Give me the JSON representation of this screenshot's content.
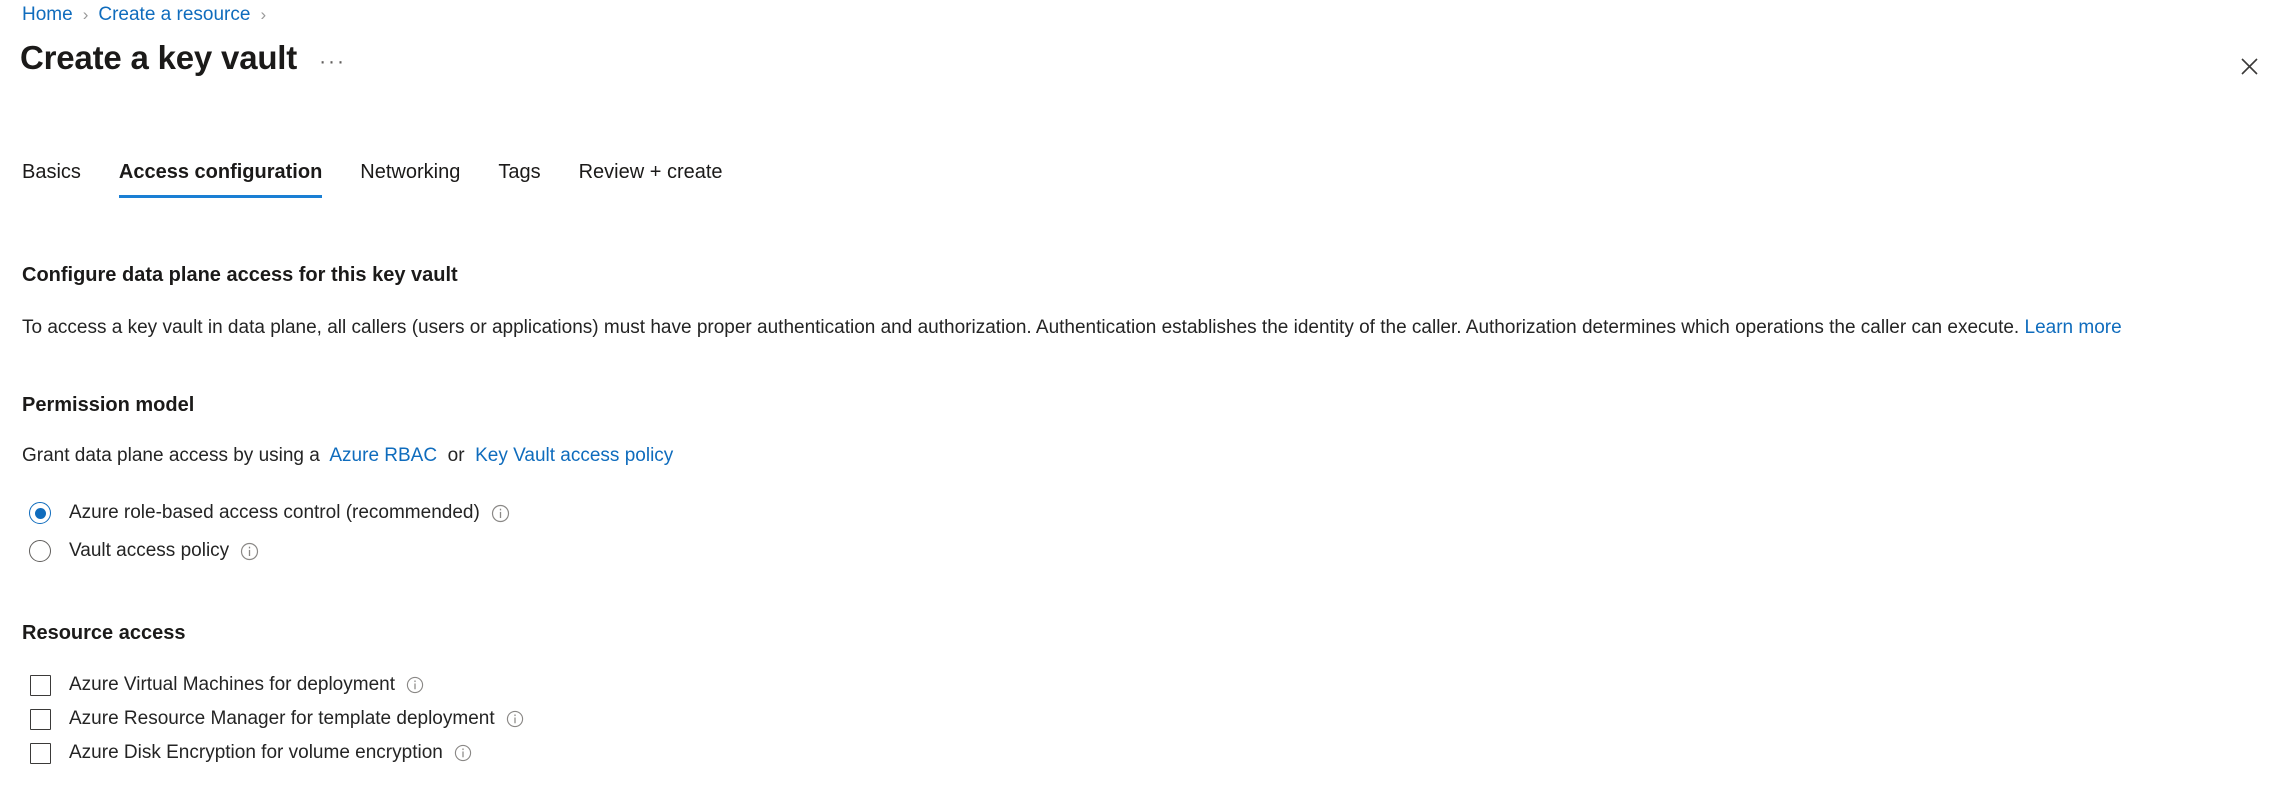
{
  "breadcrumb": {
    "items": [
      {
        "label": "Home"
      },
      {
        "label": "Create a resource"
      }
    ],
    "separator": "›"
  },
  "header": {
    "title": "Create a key vault",
    "more_label": "···",
    "close_label": "Close"
  },
  "tabs": [
    {
      "label": "Basics",
      "active": false
    },
    {
      "label": "Access configuration",
      "active": true
    },
    {
      "label": "Networking",
      "active": false
    },
    {
      "label": "Tags",
      "active": false
    },
    {
      "label": "Review + create",
      "active": false
    }
  ],
  "main": {
    "configure_heading": "Configure data plane access for this key vault",
    "configure_desc": "To access a key vault in data plane, all callers (users or applications) must have proper authentication and authorization. Authentication establishes the identity of the caller. Authorization determines which operations the caller can execute.",
    "configure_desc_link": "Learn more",
    "permission_heading": "Permission model",
    "permission_desc_prefix": "Grant data plane access by using a",
    "permission_link_rbac": "Azure RBAC",
    "permission_desc_or": "or",
    "permission_link_policy": "Key Vault access policy",
    "permission_options": [
      {
        "label": "Azure role-based access control (recommended)",
        "selected": true,
        "info": "info-icon"
      },
      {
        "label": "Vault access policy",
        "selected": false,
        "info": "info-icon"
      }
    ],
    "resource_heading": "Resource access",
    "resource_options": [
      {
        "label": "Azure Virtual Machines for deployment",
        "checked": false,
        "info": "info-icon"
      },
      {
        "label": "Azure Resource Manager for template deployment",
        "checked": false,
        "info": "info-icon"
      },
      {
        "label": "Azure Disk Encryption for volume encryption",
        "checked": false,
        "info": "info-icon"
      }
    ]
  },
  "colors": {
    "link": "#0f6cbd",
    "tab_underline": "#1a7fd4",
    "text": "#242424",
    "muted": "#605e5c"
  }
}
